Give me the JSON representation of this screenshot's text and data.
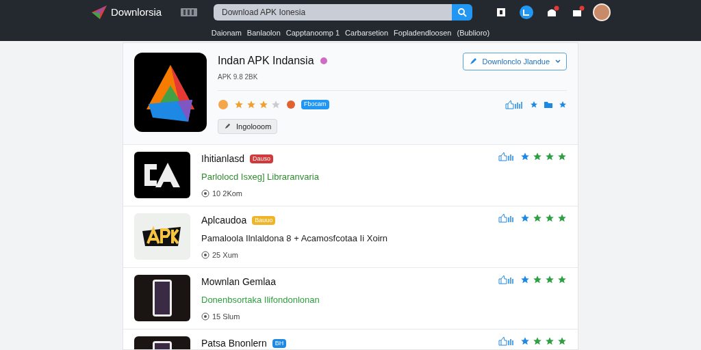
{
  "header": {
    "logo_text": "Downlorsia",
    "search": {
      "placeholder": "Download APK Ionesia"
    },
    "notifications": [
      {
        "kind": "plain",
        "badge": false
      },
      {
        "kind": "round",
        "badge": false
      },
      {
        "kind": "bell",
        "badge": true
      },
      {
        "kind": "gift",
        "badge": true
      }
    ],
    "nav": [
      "Daionam",
      "Banlaolon",
      "Capptanoomp 1",
      "Carbarsetion",
      "Fopladendloosen",
      "(Bublioro)"
    ]
  },
  "featured": {
    "title": "Indan APK Indansia",
    "subtitle": "APK 9.8 2BK",
    "stars": 3,
    "badge": "Fbocam",
    "chip": "Ingolooom",
    "button": "Downlonclo Jlandue"
  },
  "apps": [
    {
      "kind": "letters",
      "name": "Ihitianlasd",
      "badge": {
        "text": "Dauso",
        "color": "#d03a3a"
      },
      "desc": "Parlolocd Isxeg] Libraranvaria",
      "color": "#2e8b2e",
      "meta": "10 2Kom",
      "stars": 3
    },
    {
      "kind": "apk",
      "name": "Aplcaudoa",
      "badge": {
        "text": "Bauuo",
        "color": "#f0b429"
      },
      "desc": "Pamaloola Ilnlaldona 8 + Acamosfcotaa Ii Xoirn",
      "color": "#222222",
      "meta": "25 Xum",
      "stars": 3
    },
    {
      "kind": "phone",
      "name": "Mownlan Gemlaa",
      "desc": "Donenbsortaka Ilifondonlonan",
      "color": "#2e9e3e",
      "meta": "15 Slum",
      "stars": 3
    },
    {
      "kind": "phone",
      "name": "Patsa Bnonlern",
      "badge": {
        "text": "BH",
        "color": "#1e88e5"
      },
      "stars": 3
    }
  ]
}
